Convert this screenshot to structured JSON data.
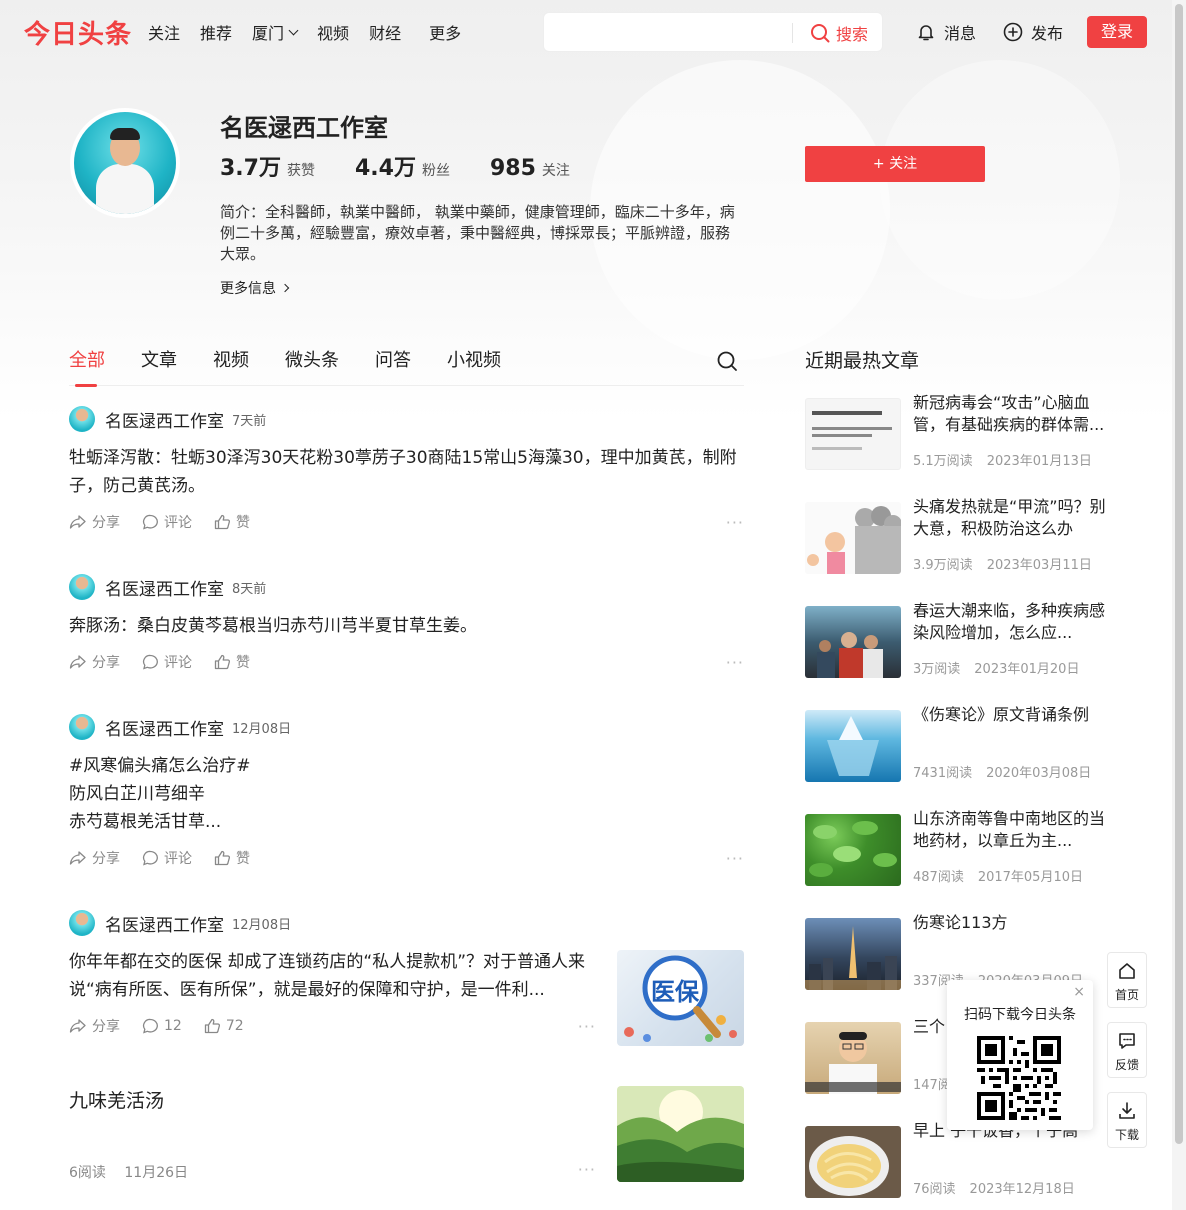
{
  "colors": {
    "accent": "#f04142",
    "text": "#222222",
    "muted": "#999999"
  },
  "header": {
    "logo": "今日头条",
    "nav": [
      "关注",
      "推荐",
      "厦门",
      "视频",
      "财经",
      "更多"
    ],
    "search_placeholder": "",
    "search_label": "搜索",
    "messages_label": "消息",
    "publish_label": "发布",
    "login_label": "登录"
  },
  "profile": {
    "name": "名医逯西工作室",
    "likes_num": "3.7万",
    "likes_label": "获赞",
    "fans_num": "4.4万",
    "fans_label": "粉丝",
    "follow_num": "985",
    "follow_label": "关注",
    "follow_button": "+ 关注",
    "bio": "简介：全科醫師，執業中醫師， 執業中藥師，健康管理師，臨床二十多年，病例二十多萬，經驗豐富，療效卓著，秉中醫經典，博採眾長；平脈辨證，服務大眾。",
    "more_info": "更多信息"
  },
  "tabs": [
    "全部",
    "文章",
    "视频",
    "微头条",
    "问答",
    "小视频"
  ],
  "feed": [
    {
      "author": "名医逯西工作室",
      "time": "7天前",
      "text": "牡蛎泽泻散：牡蛎30泽泻30天花粉30葶苈子30商陆15常山5海藻30，理中加黄芪，制附子，防己黄芪汤。",
      "share": "分享",
      "comment": "评论",
      "like": "赞"
    },
    {
      "author": "名医逯西工作室",
      "time": "8天前",
      "text": "奔豚汤：桑白皮黄芩葛根当归赤芍川芎半夏甘草生姜。",
      "share": "分享",
      "comment": "评论",
      "like": "赞"
    },
    {
      "author": "名医逯西工作室",
      "time": "12月08日",
      "line1": "#风寒偏头痛怎么治疗#",
      "line2": "防风白芷川芎细辛",
      "line3": "赤芍葛根羌活甘草...",
      "share": "分享",
      "comment": "评论",
      "like": "赞"
    },
    {
      "author": "名医逯西工作室",
      "time": "12月08日",
      "text": "你年年都在交的医保 却成了连锁药店的“私人提款机”？对于普通人来说“病有所医、医有所保”，就是最好的保障和守护，是一件利...",
      "share": "分享",
      "comment": "12",
      "like": "72",
      "image_text": "医保"
    },
    {
      "title": "九味羌活汤",
      "reads": "6阅读",
      "date": "11月26日"
    }
  ],
  "sidebar": {
    "title": "近期最热文章",
    "articles": [
      {
        "title": "新冠病毒会“攻击”心脑血管，有基础疾病的群体需...",
        "reads": "5.1万阅读",
        "date": "2023年01月13日"
      },
      {
        "title": "头痛发热就是“甲流”吗？别大意，积极防治这么办",
        "reads": "3.9万阅读",
        "date": "2023年03月11日"
      },
      {
        "title": "春运大潮来临，多种疾病感染风险增加，怎么应...",
        "reads": "3万阅读",
        "date": "2023年01月20日"
      },
      {
        "title": "《伤寒论》原文背诵条例",
        "reads": "7431阅读",
        "date": "2020年03月08日"
      },
      {
        "title": "山东济南等鲁中南地区的当地药材，以章丘为主...",
        "reads": "487阅读",
        "date": "2017年05月10日"
      },
      {
        "title": "伤寒论113方",
        "reads": "337阅读",
        "date": "2020年03月09日"
      },
      {
        "title": "三个",
        "reads": "147阅",
        "date": ""
      },
      {
        "title": "早上 子干饭香，个子高",
        "reads": "76阅读",
        "date": "2023年12月18日"
      }
    ]
  },
  "qr_popup": {
    "text": "扫码下载今日头条",
    "close": "×"
  },
  "float_buttons": {
    "home": "首页",
    "feedback": "反馈",
    "download": "下载"
  }
}
